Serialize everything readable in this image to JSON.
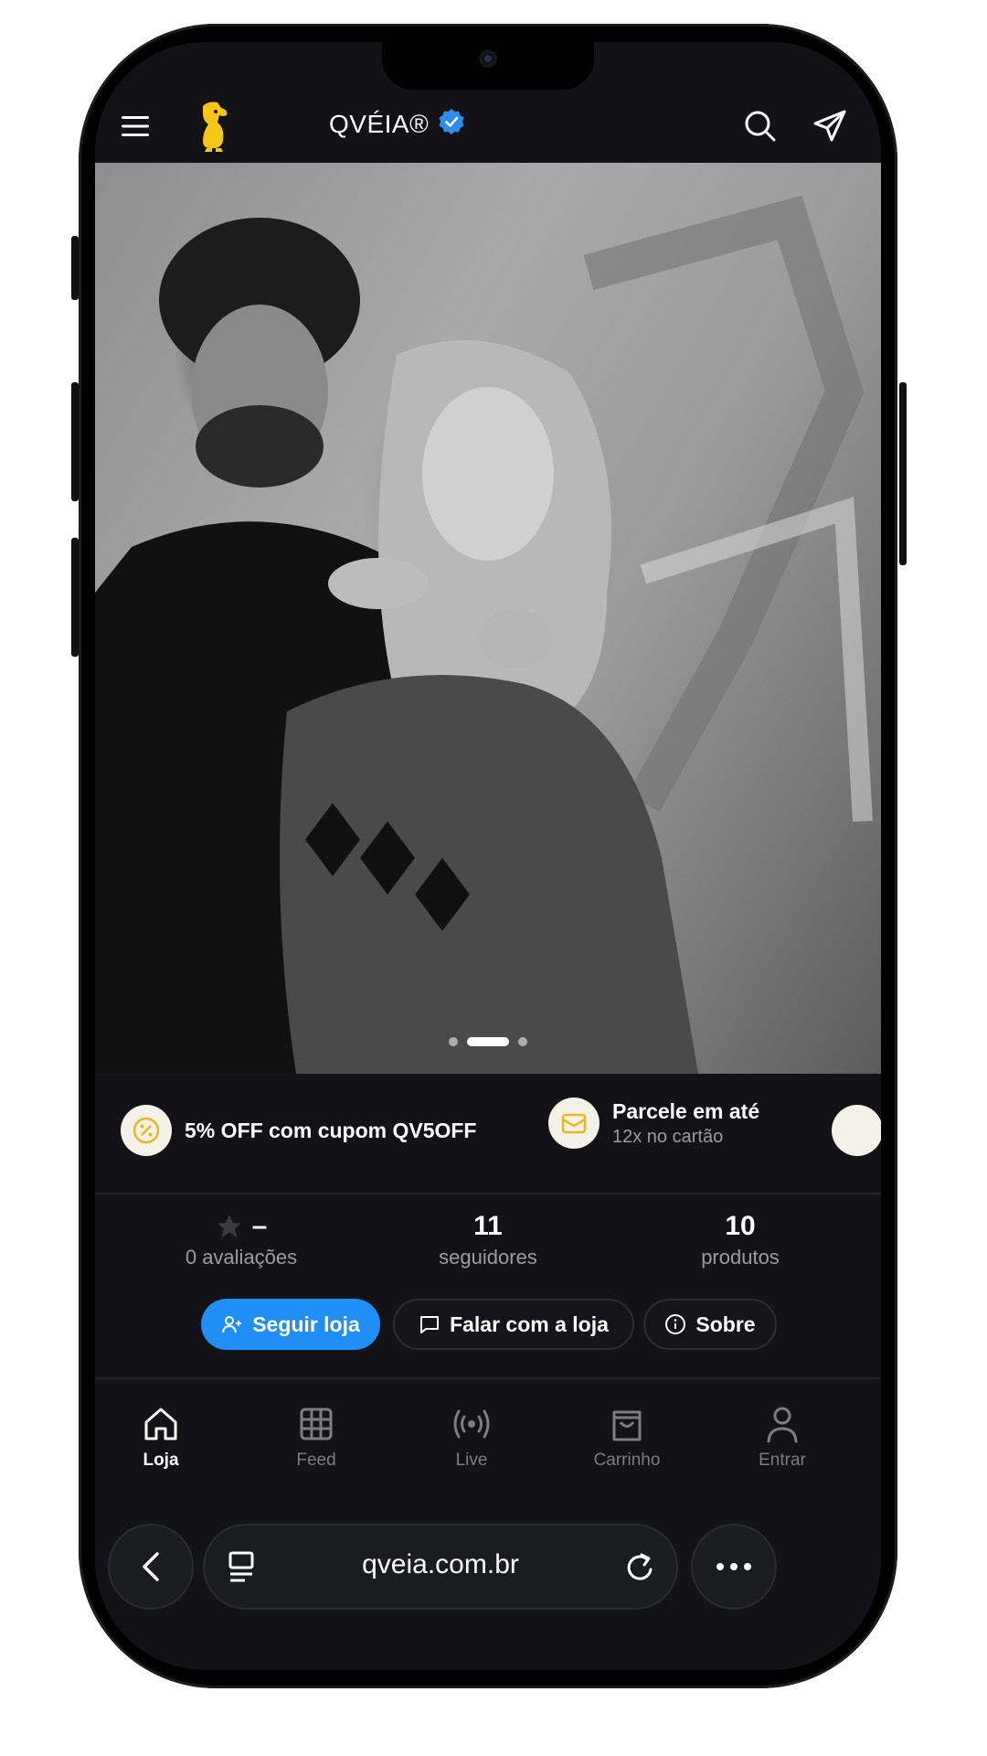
{
  "header": {
    "brand_name": "QVÉIA®",
    "icons": [
      "menu-icon",
      "mascot-logo",
      "verified-badge-icon",
      "search-icon",
      "send-icon"
    ]
  },
  "hero": {
    "image_description_icon": "photo",
    "carousel_dots": 3,
    "active_dot": 1
  },
  "promos": [
    {
      "title": "5% OFF com cupom QV5OFF",
      "subtitle": "",
      "icon": "percent-coupon-icon"
    },
    {
      "title": "Parcele em até",
      "subtitle": "12x no cartão",
      "icon": "card-icon"
    }
  ],
  "stats": {
    "rating_value": "–",
    "rating_label": "0 avaliações",
    "followers_value": "11",
    "followers_label": "seguidores",
    "products_value": "10",
    "products_label": "produtos"
  },
  "actions": {
    "follow_label": "Seguir loja",
    "chat_label": "Falar com a loja",
    "about_label": "Sobre"
  },
  "tabbar": [
    {
      "label": "Loja",
      "icon": "home-icon",
      "active": true
    },
    {
      "label": "Feed",
      "icon": "grid-icon",
      "active": false
    },
    {
      "label": "Live",
      "icon": "broadcast-icon",
      "active": false
    },
    {
      "label": "Carrinho",
      "icon": "bag-icon",
      "active": false
    },
    {
      "label": "Entrar",
      "icon": "user-icon",
      "active": false
    }
  ],
  "browser": {
    "url": "qveia.com.br"
  },
  "colors": {
    "background": "#121217",
    "accent": "#1f8ef5",
    "brand_yellow": "#f5c518"
  }
}
